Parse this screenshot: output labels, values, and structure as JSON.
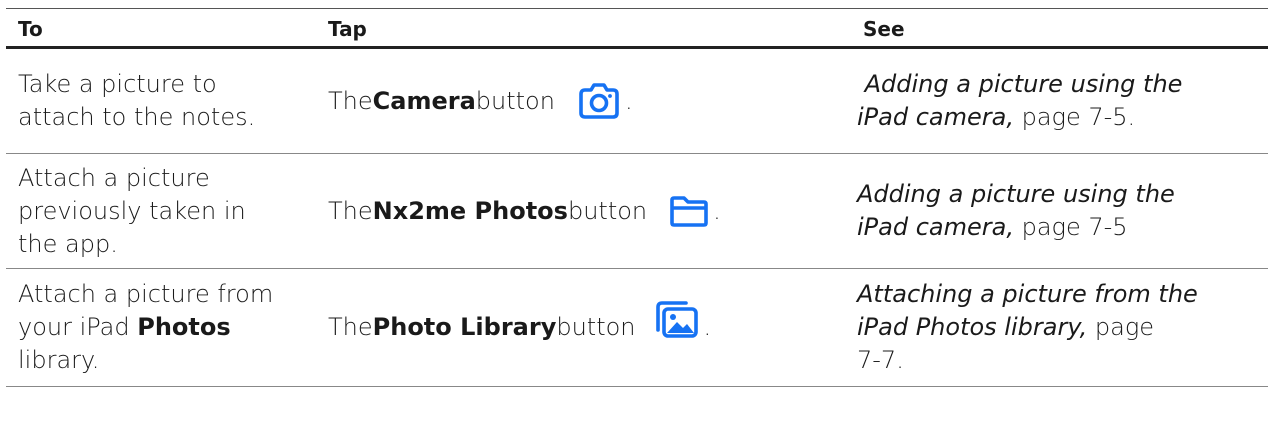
{
  "table": {
    "headers": {
      "to": "To",
      "tap": "Tap",
      "see": "See"
    },
    "rows": [
      {
        "to_lines": [
          "Take a picture to",
          "attach to the notes."
        ],
        "tap_prefix": "The ",
        "tap_strong": "Camera",
        "tap_suffix": " button",
        "tap_end": ".",
        "icon": "camera-icon",
        "see_italic_lines": [
          " Adding a picture using the",
          "iPad camera,"
        ],
        "see_page": " page 7-5."
      },
      {
        "to_lines": [
          "Attach a picture",
          "previously taken in",
          "the app."
        ],
        "tap_prefix": "The ",
        "tap_strong": "Nx2me Photos",
        "tap_suffix": " button",
        "tap_end": ".",
        "icon": "folder-icon",
        "see_italic_lines": [
          "Adding a picture using the",
          "iPad camera,"
        ],
        "see_page": " page 7-5"
      },
      {
        "to_line1": "Attach a picture from",
        "to_line2_prefix": "your iPad ",
        "to_line2_strong": "Photos",
        "to_line3": "library.",
        "tap_prefix": "The ",
        "tap_strong": "Photo Library",
        "tap_suffix": " button",
        "tap_end": ".",
        "icon": "photo-library-icon",
        "see_italic_lines": [
          "Attaching a picture from the",
          "iPad Photos library,"
        ],
        "see_page_lines": [
          " page",
          "7-7."
        ]
      }
    ]
  },
  "colors": {
    "icon_blue": "#1672F3",
    "text": "#1a1a1a",
    "rule": "#888888"
  }
}
